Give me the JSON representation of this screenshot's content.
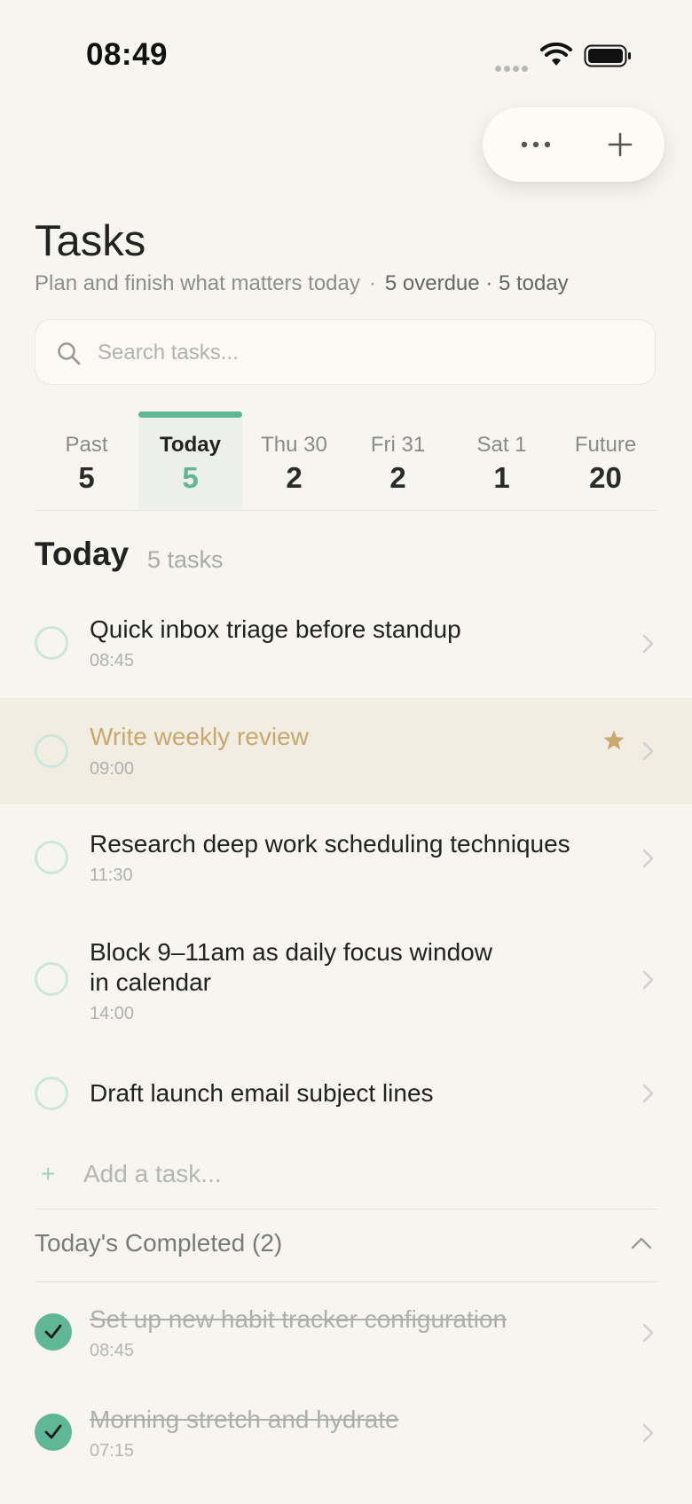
{
  "status_bar": {
    "time": "08:49"
  },
  "header": {
    "title": "Tasks",
    "subtitle": "Plan and finish what matters today",
    "stats": "5 overdue · 5 today",
    "more_icon": "ellipsis-icon",
    "add_icon": "plus-icon"
  },
  "search": {
    "placeholder": "Search tasks...",
    "value": ""
  },
  "date_tabs": [
    {
      "label": "Past",
      "count": "5",
      "active": false
    },
    {
      "label": "Today",
      "count": "5",
      "active": true
    },
    {
      "label": "Thu 30",
      "count": "2",
      "active": false
    },
    {
      "label": "Fri 31",
      "count": "2",
      "active": false
    },
    {
      "label": "Sat 1",
      "count": "1",
      "active": false
    },
    {
      "label": "Future",
      "count": "20",
      "active": false
    }
  ],
  "section": {
    "title": "Today",
    "count": "5 tasks"
  },
  "tasks": [
    {
      "title": "Quick inbox triage before standup",
      "time": "08:45",
      "starred": false
    },
    {
      "title": "Write weekly review",
      "time": "09:00",
      "starred": true
    },
    {
      "title": "Research deep work scheduling techniques",
      "time": "11:30",
      "starred": false
    },
    {
      "title_line1": "Block 9–11am as daily focus window",
      "title_line2": "in calendar",
      "time": "14:00",
      "starred": false
    },
    {
      "title": "Draft launch email subject lines",
      "time": "",
      "starred": false
    }
  ],
  "add_task": {
    "plus": "+",
    "label": "Add a task..."
  },
  "completed": {
    "label": "Today's Completed (2)",
    "items": [
      {
        "title": "Set up new habit tracker configuration",
        "time": "08:45"
      },
      {
        "title": "Morning stretch and hydrate",
        "time": "07:15"
      }
    ]
  },
  "colors": {
    "accent": "#5fb797",
    "highlight_bg": "#f1ede3",
    "star": "#c9a86e",
    "background": "#f7f5f0"
  }
}
